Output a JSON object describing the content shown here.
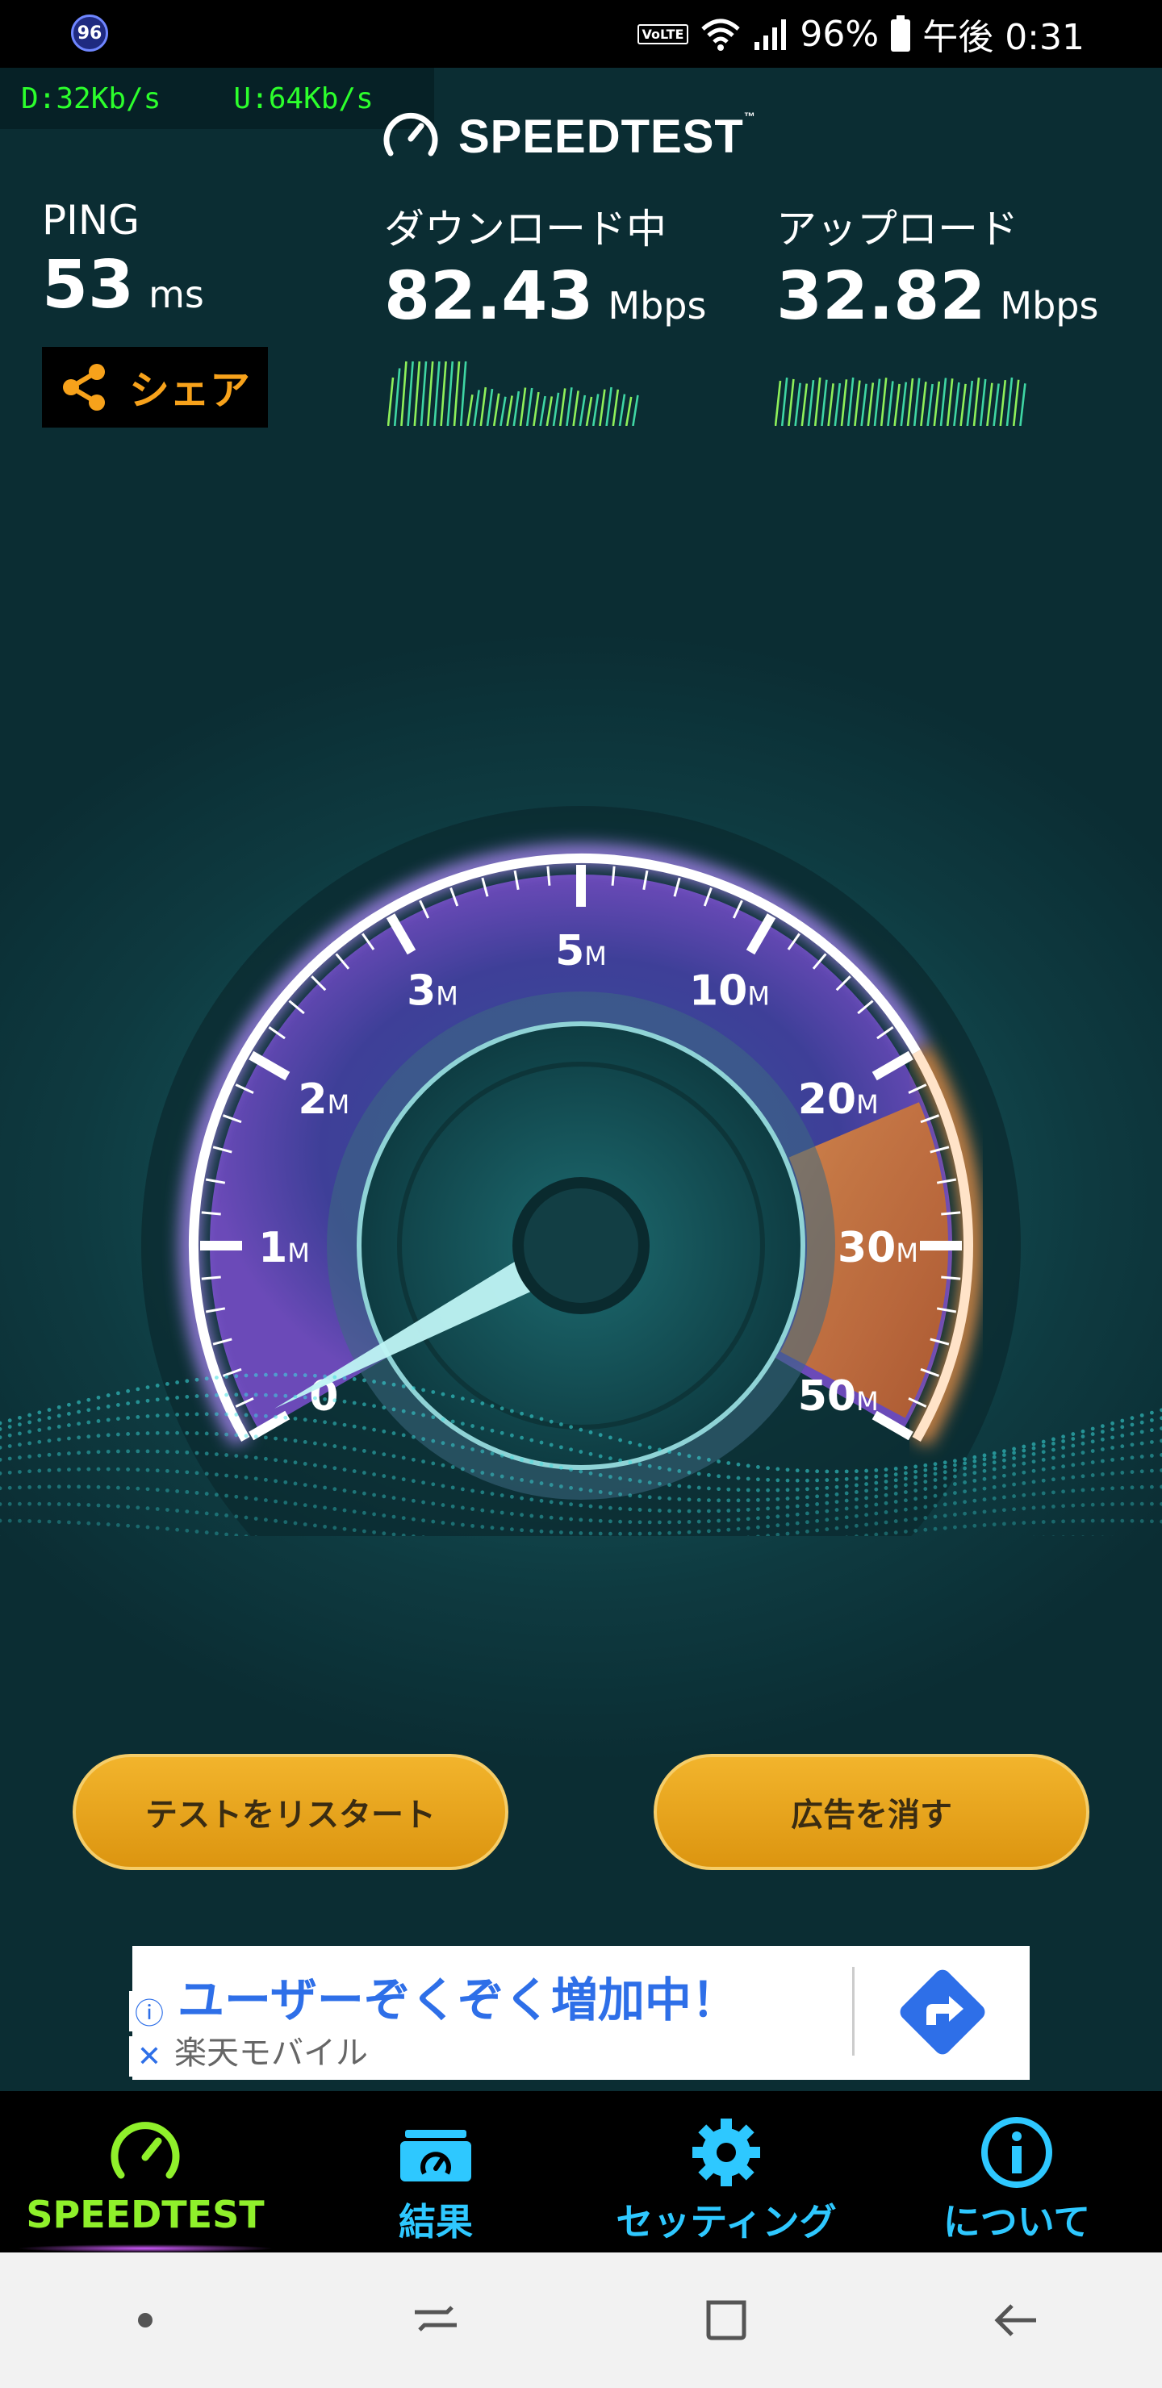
{
  "status_bar": {
    "badge": "96",
    "network_label": "VoLTE",
    "battery_percent": "96%",
    "time": "午後 0:31"
  },
  "network_monitor": {
    "download": "D:32Kb/s",
    "upload": "U:64Kb/s"
  },
  "brand": {
    "name": "SPEEDTEST",
    "trademark": "™"
  },
  "ping": {
    "label": "PING",
    "value": "53",
    "unit": "ms"
  },
  "download": {
    "label": "ダウンロード中",
    "value": "82.43",
    "unit": "Mbps"
  },
  "upload": {
    "label": "アップロード",
    "value": "32.82",
    "unit": "Mbps"
  },
  "share": {
    "label": "シェア"
  },
  "gauge": {
    "tick_labels": [
      {
        "num": "0",
        "unit": ""
      },
      {
        "num": "1",
        "unit": "M"
      },
      {
        "num": "2",
        "unit": "M"
      },
      {
        "num": "3",
        "unit": "M"
      },
      {
        "num": "5",
        "unit": "M"
      },
      {
        "num": "10",
        "unit": "M"
      },
      {
        "num": "20",
        "unit": "M"
      },
      {
        "num": "30",
        "unit": "M"
      },
      {
        "num": "50",
        "unit": "M"
      }
    ]
  },
  "buttons": {
    "restart": "テストをリスタート",
    "remove_ads": "広告を消す"
  },
  "ad": {
    "title": "ユーザーぞくぞく増加中！",
    "sponsor": "楽天モバイル",
    "info_icon": "info-icon",
    "close_icon": "close-icon"
  },
  "bottom_nav": {
    "items": [
      {
        "label": "SPEEDTEST",
        "icon": "speedometer-icon"
      },
      {
        "label": "結果",
        "icon": "results-folder-icon"
      },
      {
        "label": "セッティング",
        "icon": "gear-icon"
      },
      {
        "label": "について",
        "icon": "info-icon"
      }
    ]
  },
  "colors": {
    "accent_orange": "#f7a21b",
    "nav_active": "#8ff02b",
    "nav_inactive": "#2ec8ff",
    "net_monitor": "#2cff2c"
  }
}
